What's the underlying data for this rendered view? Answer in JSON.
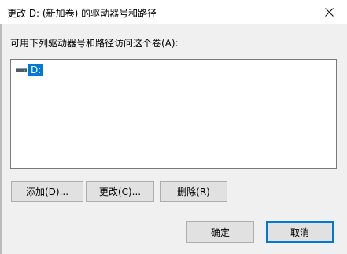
{
  "window": {
    "title": "更改 D: (新加卷) 的驱动器号和路径"
  },
  "list": {
    "label": "可用下列驱动器号和路径访问这个卷(A):",
    "items": [
      {
        "label": "D:",
        "icon": "drive-icon",
        "selected": true
      }
    ]
  },
  "actions": {
    "add_label": "添加(D)...",
    "change_label": "更改(C)...",
    "delete_label": "删除(R)"
  },
  "footer": {
    "ok_label": "确定",
    "cancel_label": "取消"
  },
  "colors": {
    "selection": "#0078d7",
    "dialog_background": "#f0f0f0",
    "button_face": "#e1e1e1"
  }
}
